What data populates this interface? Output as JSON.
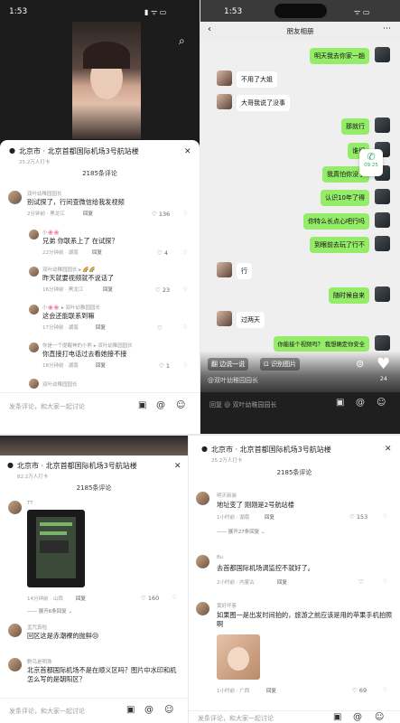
{
  "panel1": {
    "status_time": "1:53",
    "location_title": "北京市 · 北京首都国际机场3号航站楼",
    "location_sub": "25.2万人打卡",
    "comment_count": "2185条评论",
    "comments": [
      {
        "user": "双叶幼稚园园长",
        "text": "别试探了，行间查微信给我发视频",
        "meta": "2分钟前 · 黑龙江",
        "reply": "回复",
        "likes": "136"
      },
      {
        "user": "小🌸🌸",
        "text": "兄弟 你联系上了 在试探？",
        "meta": "22分钟前 · 湖南",
        "reply": "回复",
        "likes": "4"
      },
      {
        "user": "双叶幼稚园园长 ▸ 🌈🌈",
        "text": "昨天就要视频就不说话了",
        "meta": "16分钟前 · 黑龙江",
        "reply": "回复",
        "likes": "23"
      },
      {
        "user": "小🌸🌸 ▸ 双叶幼稚园园长",
        "text": "这会还能联系到嘛",
        "meta": "17分钟前 · 湖南",
        "reply": "回复",
        "likes": ""
      },
      {
        "user": "你是一个提醒神的小熊 ▸ 双叶幼稚园园长",
        "text": "你直接打电话过去看她接不接",
        "meta": "18分钟前 · 湖南",
        "reply": "回复",
        "likes": "1"
      },
      {
        "user": "双叶幼稚园园长",
        "text": "",
        "meta": "",
        "reply": "",
        "likes": ""
      }
    ],
    "input_placeholder": "发条评论，和大家一起讨论"
  },
  "panel2": {
    "status_time": "1:53",
    "chat_title": "朋友相册",
    "messages": [
      {
        "side": "right",
        "text": "明天我去你家一趟"
      },
      {
        "side": "left",
        "text": "不用了大姐"
      },
      {
        "side": "left",
        "text": "大哥我说了没事"
      },
      {
        "side": "right",
        "text": "那就行"
      },
      {
        "side": "right",
        "text": "谁们"
      },
      {
        "side": "right",
        "text": "我真怕你没了"
      },
      {
        "side": "right",
        "text": "认识10年了得"
      },
      {
        "side": "right",
        "text": "你特么长点心吧行吗"
      },
      {
        "side": "right",
        "text": "到眼前去玩了行不"
      },
      {
        "side": "left",
        "text": "行"
      },
      {
        "side": "right",
        "text": "随时候自来"
      },
      {
        "side": "left",
        "text": "过两天"
      },
      {
        "side": "right",
        "text": "你能接个视频吗？ 我想确定你安全"
      }
    ],
    "call_time": "09:25",
    "translate_label": "翻 边说一说",
    "recognize_label": "识别图片",
    "shared_by": "@双叶幼稚园园长",
    "likes": "24",
    "reply_placeholder": "回复 @ 双叶幼稚园园长"
  },
  "panel3": {
    "location_title": "北京市 · 北京首都国际机场3号航站楼",
    "location_sub": "82.2万人打卡",
    "comment_count": "2185条评论",
    "comments": [
      {
        "user": "TT",
        "meta": "14分钟前 · 山西",
        "reply": "回复",
        "likes": "160",
        "expand": "展开6条回复"
      },
      {
        "user": "孟咒真啦",
        "text": "回区这是赤潮裸的抛鲜😒",
        "meta": ""
      },
      {
        "user": "野鸟是明珠",
        "text": "北京首都国际机场不是在顺义区吗？图片中水印和机怎么写的是朝阳区？",
        "meta": ""
      }
    ],
    "input_placeholder": "发条评论，和大家一起讨论"
  },
  "panel4": {
    "location_title": "北京市 · 北京首都国际机场3号航站楼",
    "location_sub": "25.2万人打卡",
    "comment_count": "2185条评论",
    "comments": [
      {
        "user": "明天新装",
        "text": "地址变了 刚刚是2号航站楼",
        "meta": "1小时前 · 湖南",
        "reply": "回复",
        "likes": "153",
        "expand": "展开27条回复"
      },
      {
        "user": "Bu",
        "text": "去首都国际机场调监控不就好了。",
        "meta": "2小时前 · 内蒙古",
        "reply": "回复",
        "likes": ""
      },
      {
        "user": "黄好坏客",
        "text": "如果图一是出发时间拍的，旅游之前应该是用的苹果手机拍照啊",
        "meta": "1小时前 · 广西",
        "reply": "回复",
        "likes": "69"
      }
    ],
    "input_placeholder": "发条评论，和大家一起讨论"
  }
}
